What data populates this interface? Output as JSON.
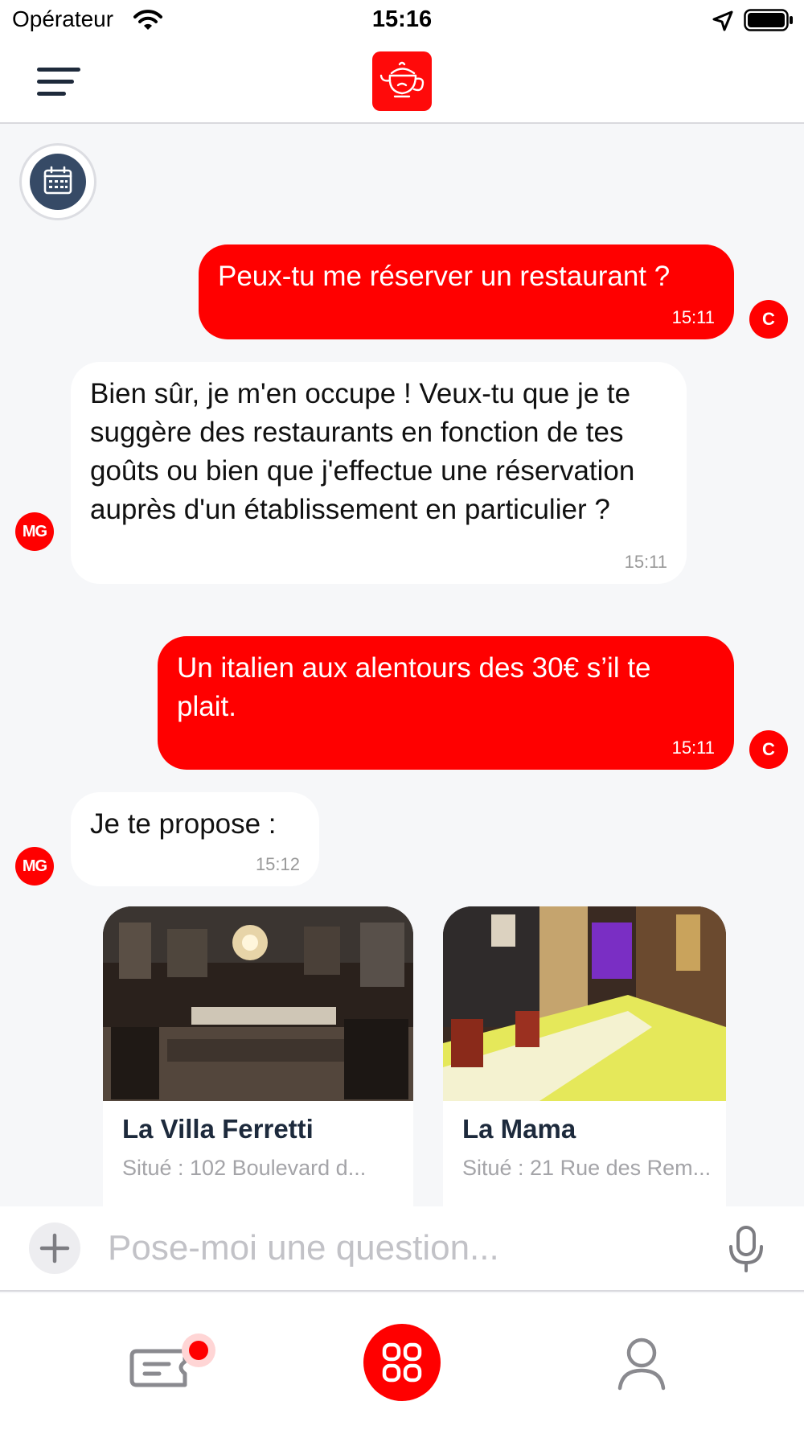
{
  "status_bar": {
    "carrier": "Opérateur",
    "time": "15:16"
  },
  "composer": {
    "placeholder": "Pose-moi une question..."
  },
  "messages": [
    {
      "sender": "C",
      "text": "Peux-tu me réserver un restaurant ?",
      "time": "15:11"
    },
    {
      "sender": "MG",
      "text": "Bien sûr, je m'en occupe ! Veux-tu que je te suggère des restaurants en fonction de tes goûts ou bien que j'effectue une réservation auprès d'un établissement en particulier ?",
      "time": "15:11"
    },
    {
      "sender": "C",
      "text": "Un italien aux alentours des 30€ s’il te plait.",
      "time": "15:11"
    },
    {
      "sender": "MG",
      "text": "Je te propose :",
      "time": "15:12"
    }
  ],
  "restaurants": [
    {
      "name": "La Villa Ferretti",
      "address": "Situé : 102 Boulevard d..."
    },
    {
      "name": "La Mama",
      "address": "Situé : 21 Rue des Rem..."
    }
  ],
  "colors": {
    "accent": "#ff0000",
    "navy": "#364a66",
    "title": "#1d2a3c",
    "background": "#f6f7f9"
  },
  "icons": [
    "wifi-icon",
    "location-arrow-icon",
    "battery-icon",
    "hamburger-menu-icon",
    "teapot-logo-icon",
    "calendar-icon",
    "plus-icon",
    "microphone-icon",
    "ticket-icon",
    "grid-icon",
    "user-icon"
  ]
}
